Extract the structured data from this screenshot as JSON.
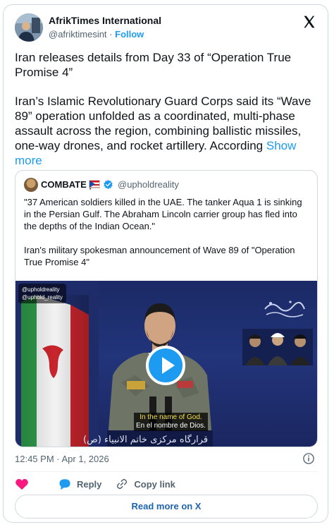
{
  "author": {
    "name": "AfrikTimes International",
    "handle": "@afriktimesint",
    "separator": "·",
    "follow_label": "Follow"
  },
  "tweet": {
    "paragraph1": "Iran releases details from Day 33 of “Operation True Promise 4”",
    "paragraph2": "Iran’s Islamic Revolutionary Guard Corps said its “Wave 89” operation unfolded as a coordinated, multi-phase assault across the region, combining ballistic missiles, one-way drones, and rocket artillery. According ",
    "show_more": "Show more"
  },
  "quoted": {
    "name": "COMBATE |",
    "handle": "@upholdreality",
    "paragraph1": "\"37 American soldiers killed in the UAE. The tanker Aqua 1 is sinking in the Persian Gulf. The Abraham Lincoln carrier group has fled into the depths of the Indian Ocean.\"",
    "paragraph2": "Iran's military spokesman announcement of Wave 89 of \"Operation True Promise 4\"",
    "media": {
      "watermark_line1": "@upholdreality",
      "watermark_line2": "@uphold_reality",
      "subtitle_line1": "In the name of God.",
      "subtitle_line2": "En el nombre de Dios.",
      "podium_text": "قرارگاه مرکزی خاتم الانبیاء (ص)",
      "play_icon": "play-icon"
    }
  },
  "meta": {
    "timestamp": "12:45 PM · Apr 1, 2026"
  },
  "actions": {
    "reply_label": "Reply",
    "copy_label": "Copy link",
    "read_more_label": "Read more on X"
  },
  "colors": {
    "accent": "#1d9bf0",
    "like": "#f91880",
    "text": "#0f1419",
    "muted": "#536471"
  }
}
